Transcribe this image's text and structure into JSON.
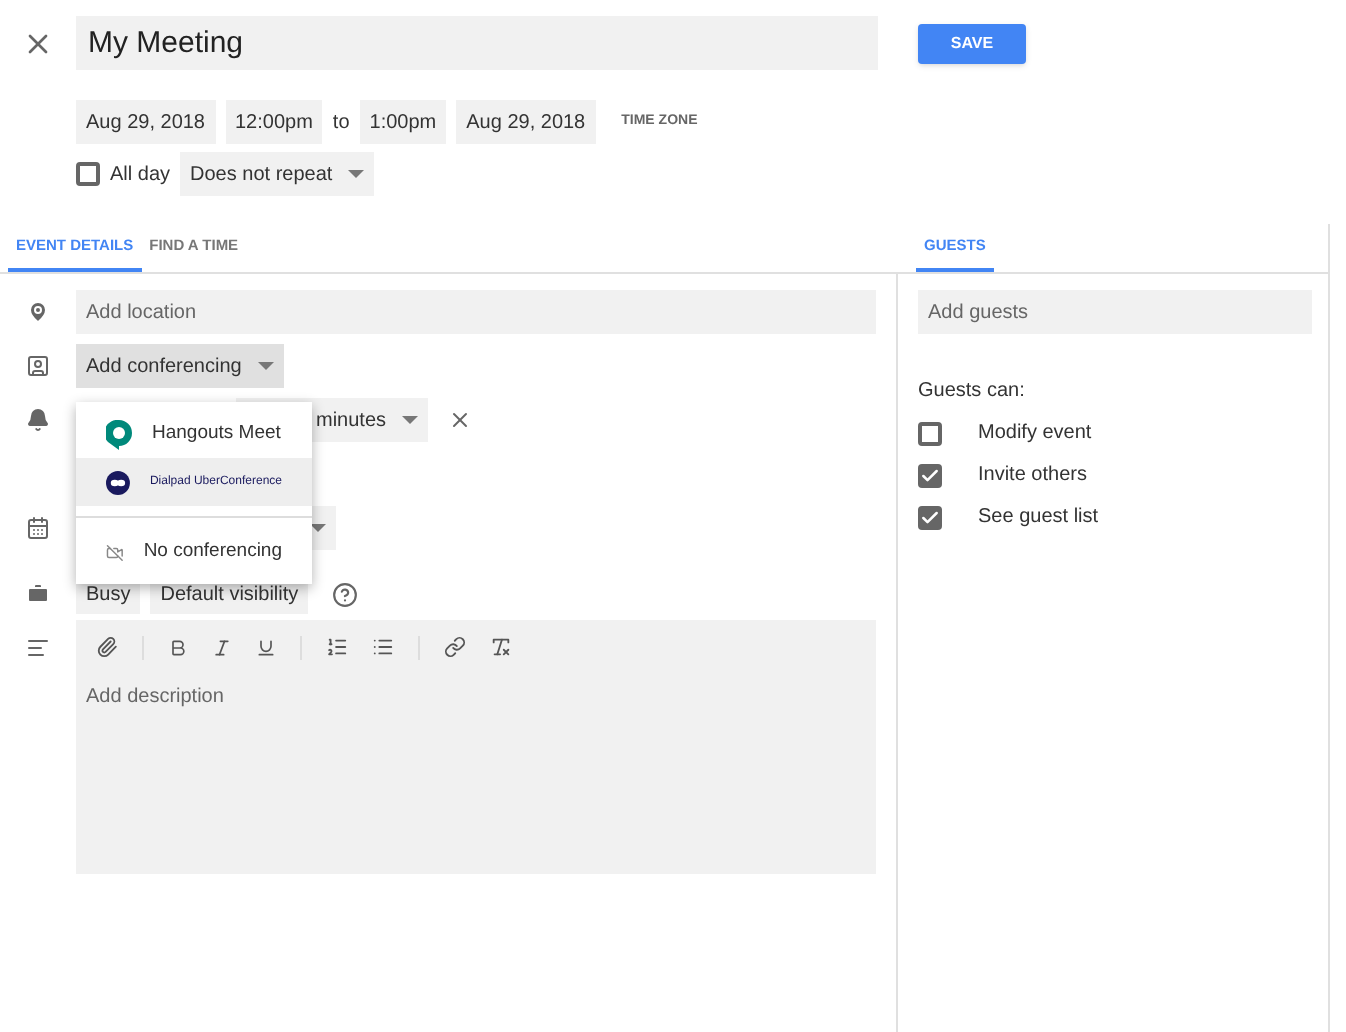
{
  "title": "My Meeting",
  "save": "SAVE",
  "dates": {
    "start_date": "Aug 29, 2018",
    "start_time": "12:00pm",
    "to": "to",
    "end_time": "1:00pm",
    "end_date": "Aug 29, 2018",
    "time_zone": "TIME ZONE"
  },
  "all_day": {
    "label": "All day",
    "checked": false
  },
  "repeat": "Does not repeat",
  "tabs": [
    {
      "label": "EVENT DETAILS",
      "selected": true
    },
    {
      "label": "FIND A TIME",
      "selected": false
    }
  ],
  "location": {
    "placeholder": "Add location"
  },
  "conferencing": "Add conferencing",
  "notification": "minutes",
  "status": "Busy",
  "visibility": "Default visibility",
  "description": {
    "placeholder": "Add description"
  },
  "conferencing_menu": [
    {
      "kind": "hangouts",
      "label": "Hangouts Meet",
      "selected": false
    },
    {
      "kind": "dialpad",
      "label": "Dialpad UberConference",
      "selected": true
    },
    {
      "kind": "none",
      "label": "No conferencing",
      "selected": false
    }
  ],
  "guests_tab": {
    "label": "GUESTS",
    "selected": true
  },
  "guests": {
    "placeholder": "Add guests"
  },
  "guests_can": "Guests can:",
  "permissions": [
    {
      "label": "Modify event",
      "checked": false
    },
    {
      "label": "Invite others",
      "checked": true
    },
    {
      "label": "See guest list",
      "checked": true
    }
  ]
}
